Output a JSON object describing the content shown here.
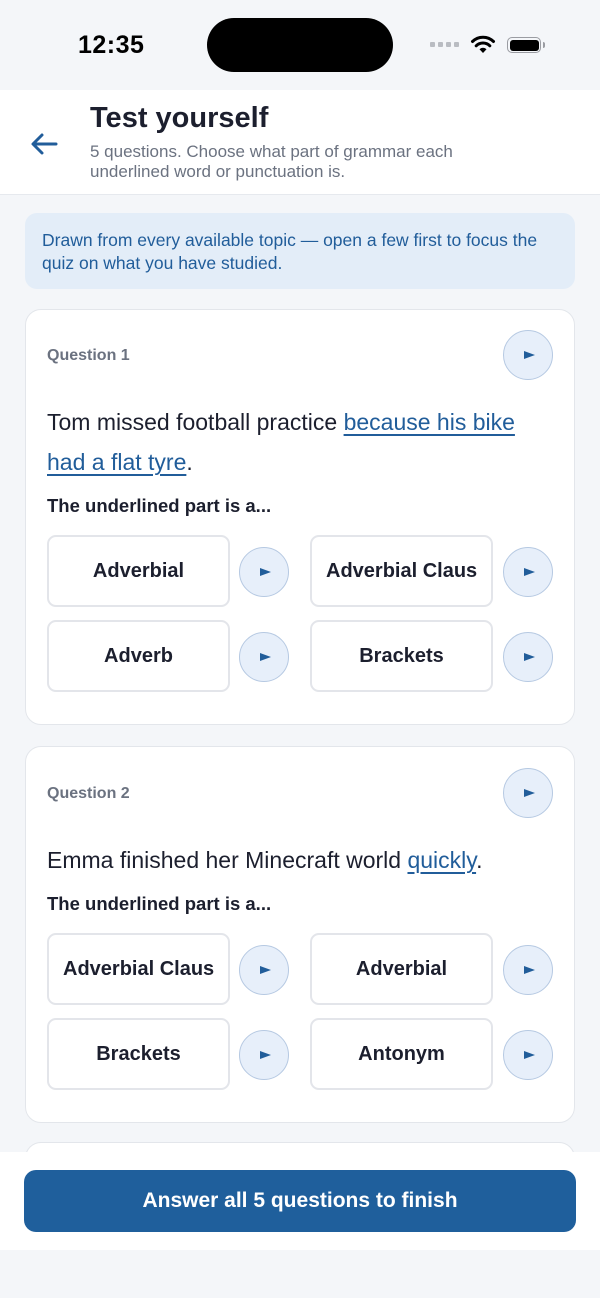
{
  "status_bar": {
    "time": "12:35"
  },
  "header": {
    "title": "Test yourself",
    "subtitle": "5 questions. Choose what part of grammar each underlined word or punctuation is.",
    "back_icon": "arrow-left-icon"
  },
  "notice": {
    "text": "Drawn from every available topic — open a few first to focus the quiz on what you have studied."
  },
  "questions": [
    {
      "label": "Question 1",
      "text_before": "Tom missed football practice ",
      "underlined": "because his bike had a flat tyre",
      "text_after": ".",
      "prompt": "The underlined part is a...",
      "options": [
        "Adverbial",
        "Adverbial Clause",
        "Adverb",
        "Brackets"
      ]
    },
    {
      "label": "Question 2",
      "text_before": "Emma finished her Minecraft world ",
      "underlined": "quickly",
      "text_after": ".",
      "prompt": "The underlined part is a...",
      "options": [
        "Adverbial Clause",
        "Adverbial",
        "Brackets",
        "Antonym"
      ]
    }
  ],
  "footer": {
    "button_label": "Answer all 5 questions to finish"
  },
  "colors": {
    "accent": "#1f5f9c",
    "notice_bg": "#e3edf8",
    "link": "#215d9a"
  }
}
